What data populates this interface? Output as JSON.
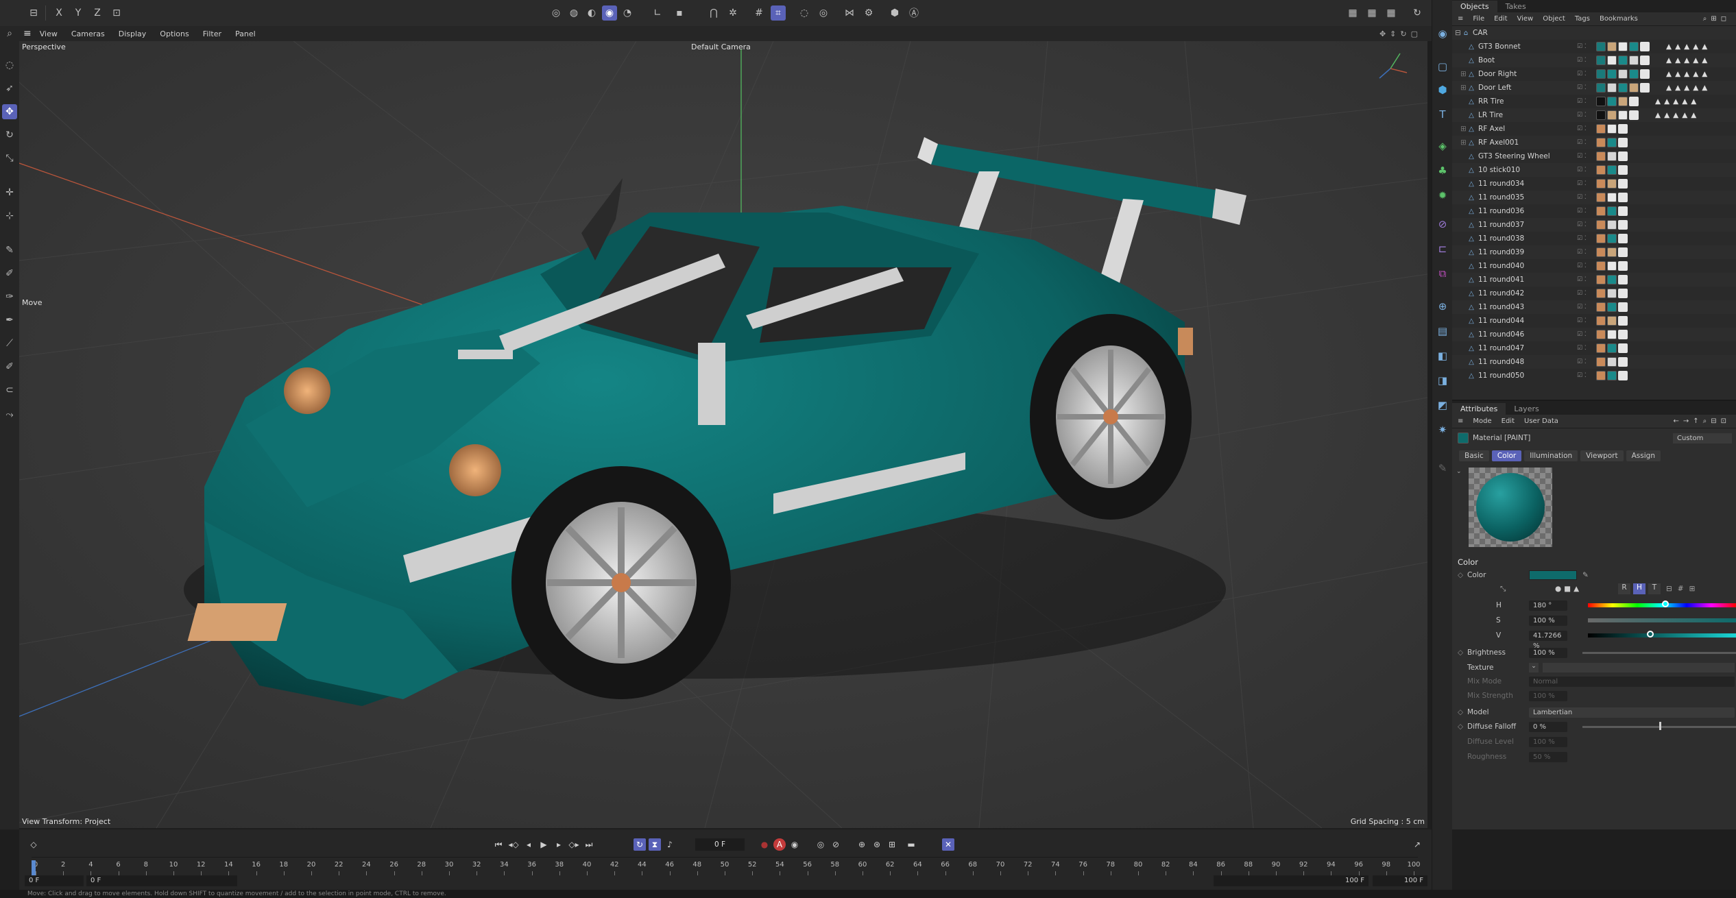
{
  "topbar": {
    "axes": [
      "X",
      "Y",
      "Z"
    ]
  },
  "viewport_menu": [
    "View",
    "Cameras",
    "Display",
    "Options",
    "Filter",
    "Panel"
  ],
  "viewport": {
    "projection": "Perspective",
    "camera": "Default Camera",
    "tool_hint": "Move",
    "view_transform": "View Transform: Project",
    "grid_spacing": "Grid Spacing : 5 cm"
  },
  "objects_panel": {
    "tabs": [
      "Objects",
      "Takes"
    ],
    "menu": [
      "File",
      "Edit",
      "View",
      "Object",
      "Tags",
      "Bookmarks"
    ],
    "root": "CAR",
    "items": [
      "GT3 Bonnet",
      "Boot",
      "Door Right",
      "Door Left",
      "RR Tire",
      "LR Tire",
      "RF Axel",
      "RF Axel001",
      "GT3 Steering Wheel",
      "10 stick010",
      "11 round034",
      "11 round035",
      "11 round036",
      "11 round037",
      "11 round038",
      "11 round039",
      "11 round040",
      "11 round041",
      "11 round042",
      "11 round043",
      "11 round044",
      "11 round046",
      "11 round047",
      "11 round048",
      "11 round050"
    ]
  },
  "attributes_panel": {
    "tabs": [
      "Attributes",
      "Layers"
    ],
    "menu": [
      "Mode",
      "Edit",
      "User Data"
    ],
    "material_name": "Material [PAINT]",
    "preset": "Custom",
    "subtabs": [
      "Basic",
      "Color",
      "Illumination",
      "Viewport",
      "Assign"
    ],
    "active_subtab": "Color",
    "section_title": "Color",
    "color_label": "Color",
    "color_swatch": "#0e6b6b",
    "channel_buttons": [
      "R",
      "H",
      "T"
    ],
    "hsv": {
      "h_label": "H",
      "h_value": "180 °",
      "s_label": "S",
      "s_value": "100 %",
      "v_label": "V",
      "v_value": "41.7266 %"
    },
    "brightness_label": "Brightness",
    "brightness_value": "100 %",
    "texture_label": "Texture",
    "mix_mode_label": "Mix Mode",
    "mix_mode_value": "Normal",
    "mix_strength_label": "Mix Strength",
    "mix_strength_value": "100 %",
    "model_label": "Model",
    "model_value": "Lambertian",
    "diffuse_falloff_label": "Diffuse Falloff",
    "diffuse_falloff_value": "0 %",
    "diffuse_level_label": "Diffuse Level",
    "diffuse_level_value": "100 %",
    "roughness_label": "Roughness",
    "roughness_value": "50 %"
  },
  "timeline": {
    "current_frame": "0 F",
    "start_field": "0 F",
    "start_field2": "0 F",
    "end_field": "100 F",
    "end_field2": "100 F",
    "ticks": [
      "0",
      "2",
      "4",
      "6",
      "8",
      "10",
      "12",
      "14",
      "16",
      "18",
      "20",
      "22",
      "24",
      "26",
      "28",
      "30",
      "32",
      "34",
      "36",
      "38",
      "40",
      "42",
      "44",
      "46",
      "48",
      "50",
      "52",
      "54",
      "56",
      "58",
      "60",
      "62",
      "64",
      "66",
      "68",
      "70",
      "72",
      "74",
      "76",
      "78",
      "80",
      "82",
      "84",
      "86",
      "88",
      "90",
      "92",
      "94",
      "96",
      "98",
      "100"
    ]
  },
  "status": "Move: Click and drag to move elements. Hold down SHIFT to quantize movement / add to the selection in point mode, CTRL to remove."
}
